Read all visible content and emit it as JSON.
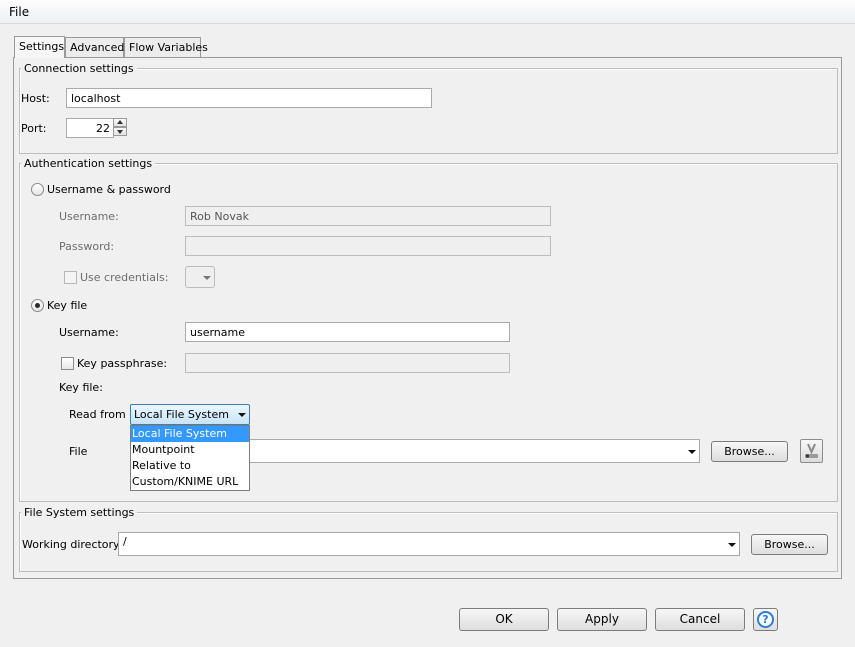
{
  "window": {
    "menu_file": "File"
  },
  "tabs": [
    {
      "label": "Settings",
      "active": true
    },
    {
      "label": "Advanced",
      "active": false
    },
    {
      "label": "Flow Variables",
      "active": false
    }
  ],
  "connection": {
    "title": "Connection settings",
    "host_label": "Host:",
    "host_value": "localhost",
    "port_label": "Port:",
    "port_value": "22"
  },
  "auth": {
    "title": "Authentication settings",
    "userpass_label": "Username & password",
    "userpass_username_label": "Username:",
    "userpass_username_value": "Rob Novak",
    "userpass_password_label": "Password:",
    "userpass_password_value": "",
    "use_credentials_label": "Use credentials:",
    "keyfile_label": "Key file",
    "keyfile_username_label": "Username:",
    "keyfile_username_value": "username",
    "key_passphrase_label": "Key passphrase:",
    "key_passphrase_value": "",
    "keyfile_section_label": "Key file:",
    "read_from_label": "Read from",
    "read_from_value": "Local File System",
    "read_from_options": [
      "Local File System",
      "Mountpoint",
      "Relative to",
      "Custom/KNIME URL"
    ],
    "file_label": "File",
    "file_value": "",
    "browse_label": "Browse..."
  },
  "filesystem": {
    "title": "File System settings",
    "working_dir_label": "Working directory:",
    "working_dir_value": "/",
    "browse_label": "Browse..."
  },
  "footer": {
    "ok": "OK",
    "apply": "Apply",
    "cancel": "Cancel",
    "help_glyph": "?"
  },
  "colors": {
    "selection": "#3399ff",
    "help_accent": "#2a7fd4"
  }
}
